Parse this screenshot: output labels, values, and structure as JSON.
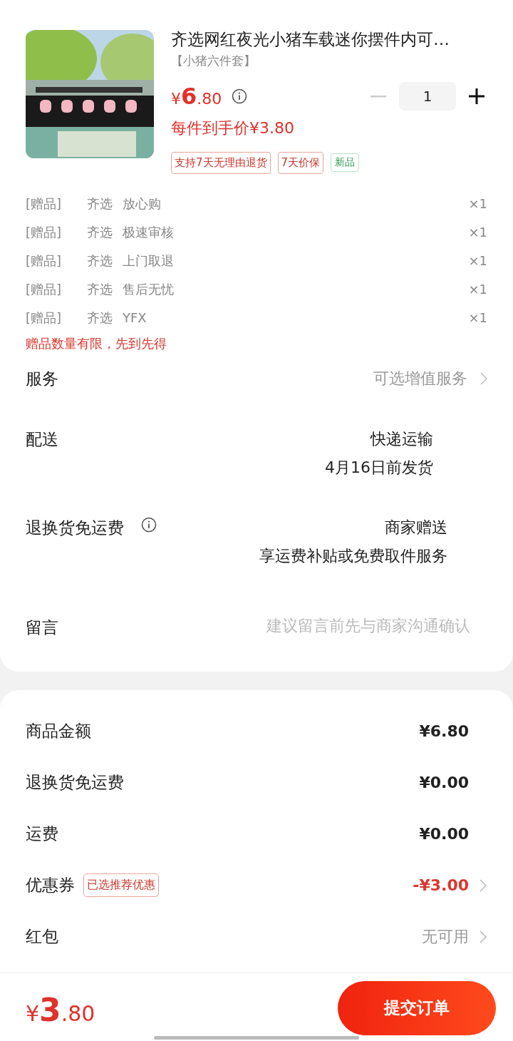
{
  "product": {
    "title": "齐选网红夜光小猪车载迷你摆件内可…",
    "variant": "【小猪六件套】",
    "price": "¥6.80",
    "final_price": "每件到手价¥3.80",
    "quantity": "1",
    "tags": [
      {
        "label": "支持7天无理由退货",
        "kind": "outline"
      },
      {
        "label": "7天价保",
        "kind": "outline"
      },
      {
        "label": "新品",
        "kind": "green"
      }
    ]
  },
  "gifts": [
    {
      "tag": "[赠品]",
      "brand": "齐选",
      "name": "放心购",
      "count": "×1"
    },
    {
      "tag": "[赠品]",
      "brand": "齐选",
      "name": "极速审核",
      "count": "×1"
    },
    {
      "tag": "[赠品]",
      "brand": "齐选",
      "name": "上门取退",
      "count": "×1"
    },
    {
      "tag": "[赠品]",
      "brand": "齐选",
      "name": "售后无忧",
      "count": "×1"
    },
    {
      "tag": "[赠品]",
      "brand": "齐选",
      "name": "YFX",
      "count": "×1"
    }
  ],
  "gift_notice": "赠品数量有限，先到先得",
  "options": [
    {
      "kind": "link",
      "label": "服务",
      "value": "可选增值服务"
    },
    {
      "kind": "text",
      "label": "配送",
      "lines": [
        "快递运输",
        "4月16日前发货"
      ]
    },
    {
      "kind": "text",
      "label": "退换货免运费",
      "info": true,
      "lines": [
        "商家赠送",
        "享运费补贴或免费取件服务"
      ]
    },
    {
      "kind": "field",
      "label": "留言",
      "placeholder": "建议留言前先与商家沟通确认"
    }
  ],
  "summary": [
    {
      "kind": "plain",
      "label": "商品金额",
      "value": "¥6.80",
      "chevron": false
    },
    {
      "kind": "plain",
      "label": "退换货免运费",
      "value": "¥0.00",
      "chevron": false
    },
    {
      "kind": "plain",
      "label": "运费",
      "value": "¥0.00",
      "chevron": false
    },
    {
      "kind": "discount",
      "label": "优惠券",
      "badge": "已选推荐优惠",
      "value": "-¥3.00",
      "chevron": true
    },
    {
      "kind": "muted",
      "label": "红包",
      "value": "无可用",
      "chevron": true
    }
  ],
  "footer": {
    "total": "¥3.80",
    "submit": "提交订单"
  }
}
